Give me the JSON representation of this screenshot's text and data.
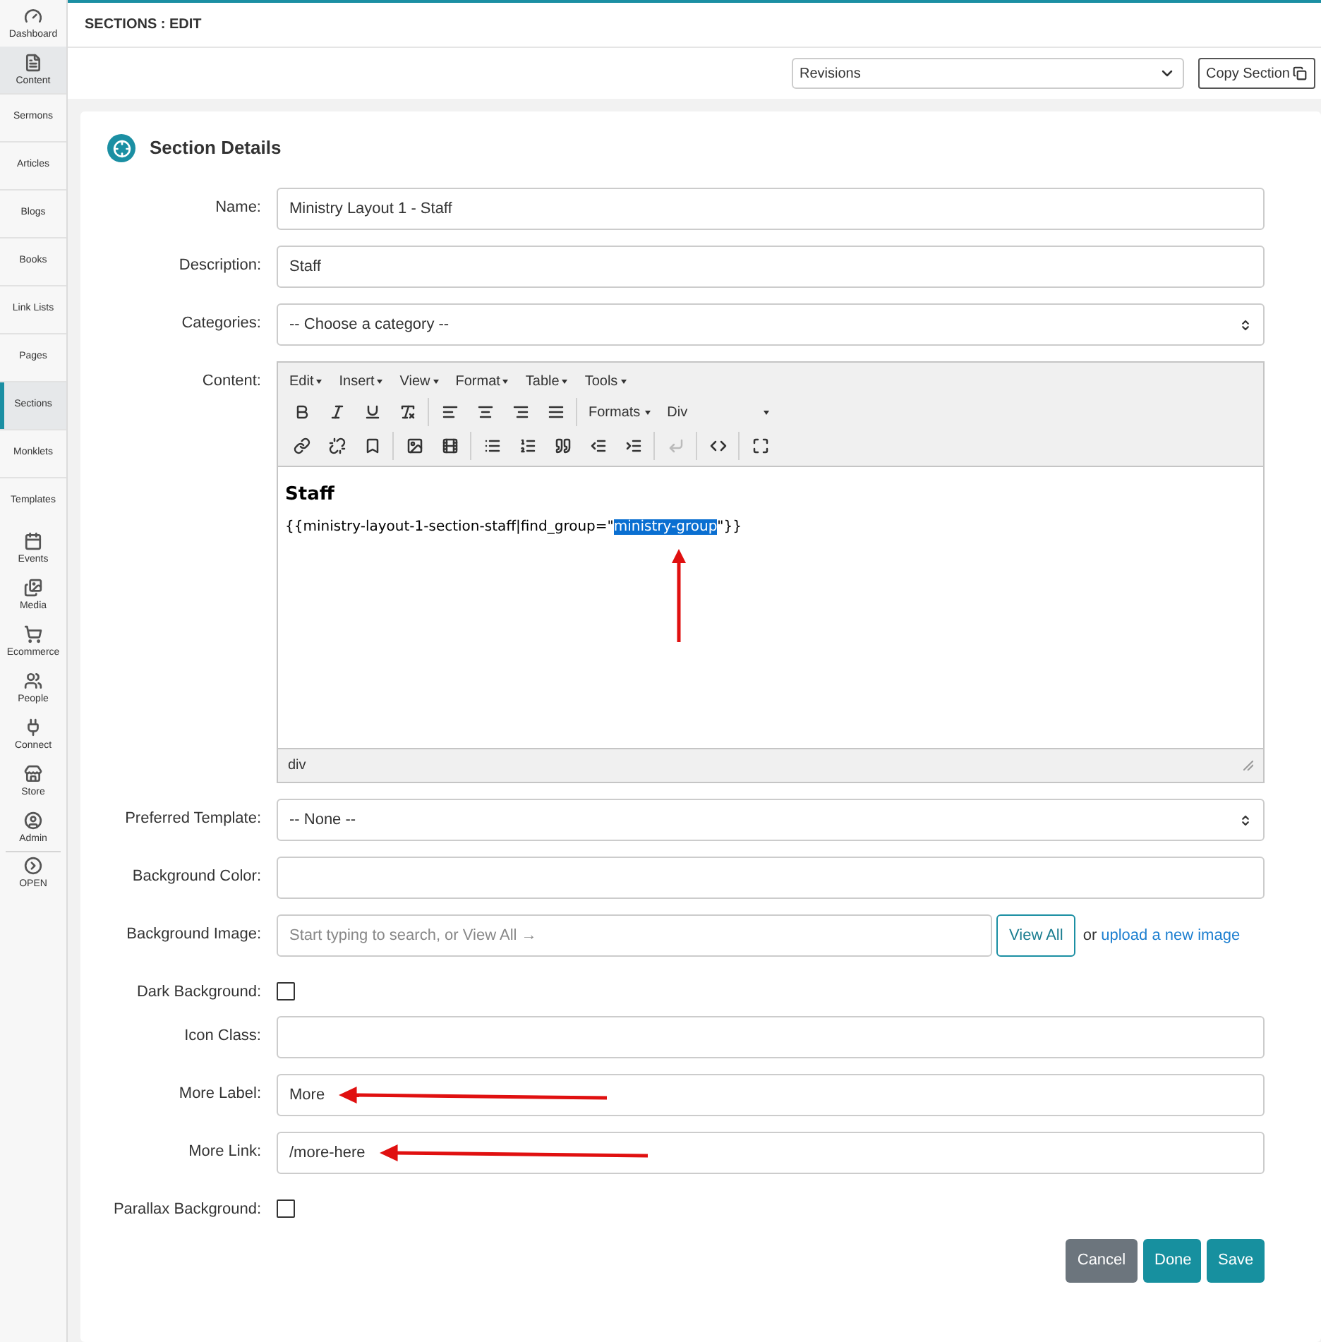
{
  "sidebar": {
    "items": [
      {
        "label": "Dashboard",
        "kind": "icon",
        "selected": false
      },
      {
        "label": "Content",
        "kind": "icon",
        "selected": true
      },
      {
        "label": "Sermons",
        "kind": "text",
        "selected": false
      },
      {
        "label": "Articles",
        "kind": "text",
        "selected": false
      },
      {
        "label": "Blogs",
        "kind": "text",
        "selected": false
      },
      {
        "label": "Books",
        "kind": "text",
        "selected": false
      },
      {
        "label": "Link Lists",
        "kind": "text",
        "selected": false
      },
      {
        "label": "Pages",
        "kind": "text",
        "selected": false
      },
      {
        "label": "Sections",
        "kind": "text",
        "selected": true
      },
      {
        "label": "Monklets",
        "kind": "text",
        "selected": false
      },
      {
        "label": "Templates",
        "kind": "text",
        "selected": false
      },
      {
        "label": "Events",
        "kind": "icon",
        "selected": false
      },
      {
        "label": "Media",
        "kind": "icon",
        "selected": false
      },
      {
        "label": "Ecommerce",
        "kind": "icon",
        "selected": false
      },
      {
        "label": "People",
        "kind": "icon",
        "selected": false
      },
      {
        "label": "Connect",
        "kind": "icon",
        "selected": false
      },
      {
        "label": "Store",
        "kind": "icon",
        "selected": false
      },
      {
        "label": "Admin",
        "kind": "icon",
        "selected": false
      },
      {
        "label": "OPEN",
        "kind": "toggle",
        "selected": false
      }
    ]
  },
  "header": {
    "title": "SECTIONS : EDIT"
  },
  "toolbar": {
    "revisions": "Revisions",
    "copy_button": "Copy Section"
  },
  "card": {
    "title": "Section Details",
    "fields": [
      {
        "kind": "text",
        "label": "Name:",
        "value": "Ministry Layout 1 - Staff"
      },
      {
        "kind": "text",
        "label": "Description:",
        "value": "Staff"
      },
      {
        "kind": "select",
        "label": "Categories:",
        "value": "-- Choose a category --"
      },
      {
        "kind": "editor",
        "label": "Content:"
      },
      {
        "kind": "select",
        "label": "Preferred Template:",
        "value": "-- None --"
      },
      {
        "kind": "text",
        "label": "Background Color:"
      },
      {
        "kind": "image",
        "label": "Background Image:",
        "placeholder": "Start typing to search, or View All →",
        "button": "View All",
        "or_text": "or",
        "link": "upload a new image"
      },
      {
        "kind": "checkbox",
        "label": "Dark Background:",
        "checked": false
      },
      {
        "kind": "text",
        "label": "Icon Class:"
      },
      {
        "kind": "text",
        "label": "More Label:",
        "value": "More",
        "arrow": true
      },
      {
        "kind": "text",
        "label": "More Link:",
        "value": "/more-here",
        "arrow": true
      },
      {
        "kind": "checkbox",
        "label": "Parallax Background:",
        "checked": false
      }
    ],
    "editor": {
      "menus": [
        "Edit",
        "Insert",
        "View",
        "Format",
        "Table",
        "Tools"
      ],
      "formats": "Formats",
      "block": "Div",
      "heading": "Staff",
      "code_before": "{{ministry-layout-1-section-staff|find_group=\"",
      "code_selected": "ministry-group",
      "code_after": "\"}}",
      "status": "div"
    },
    "buttons": [
      {
        "label": "Cancel",
        "kind": "secondary"
      },
      {
        "label": "Done",
        "kind": "primary"
      },
      {
        "label": "Save",
        "kind": "primary"
      }
    ]
  }
}
